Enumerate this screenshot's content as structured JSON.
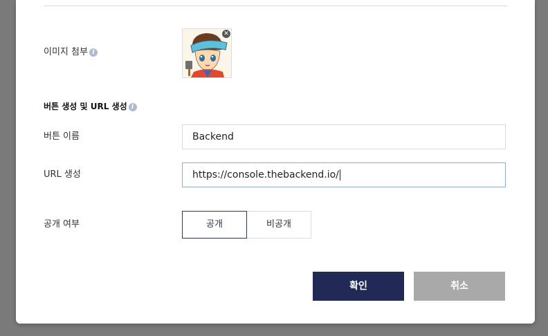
{
  "form": {
    "image_label": "이미지 첨부",
    "section_title": "버튼 생성 및 URL 생성",
    "button_name_label": "버튼 이름",
    "button_name_value": "Backend",
    "url_label": "URL 생성",
    "url_value": "https://console.thebackend.io/",
    "visibility_label": "공개 여부",
    "visibility_options": [
      "공개",
      "비공개"
    ],
    "visibility_selected": "공개"
  },
  "actions": {
    "confirm_label": "확인",
    "cancel_label": "취소"
  },
  "icons": {
    "info": "info-icon",
    "remove": "close-icon"
  },
  "colors": {
    "primary": "#212a57",
    "secondary": "#a9a9a9",
    "focus_border": "#8da9c9"
  }
}
